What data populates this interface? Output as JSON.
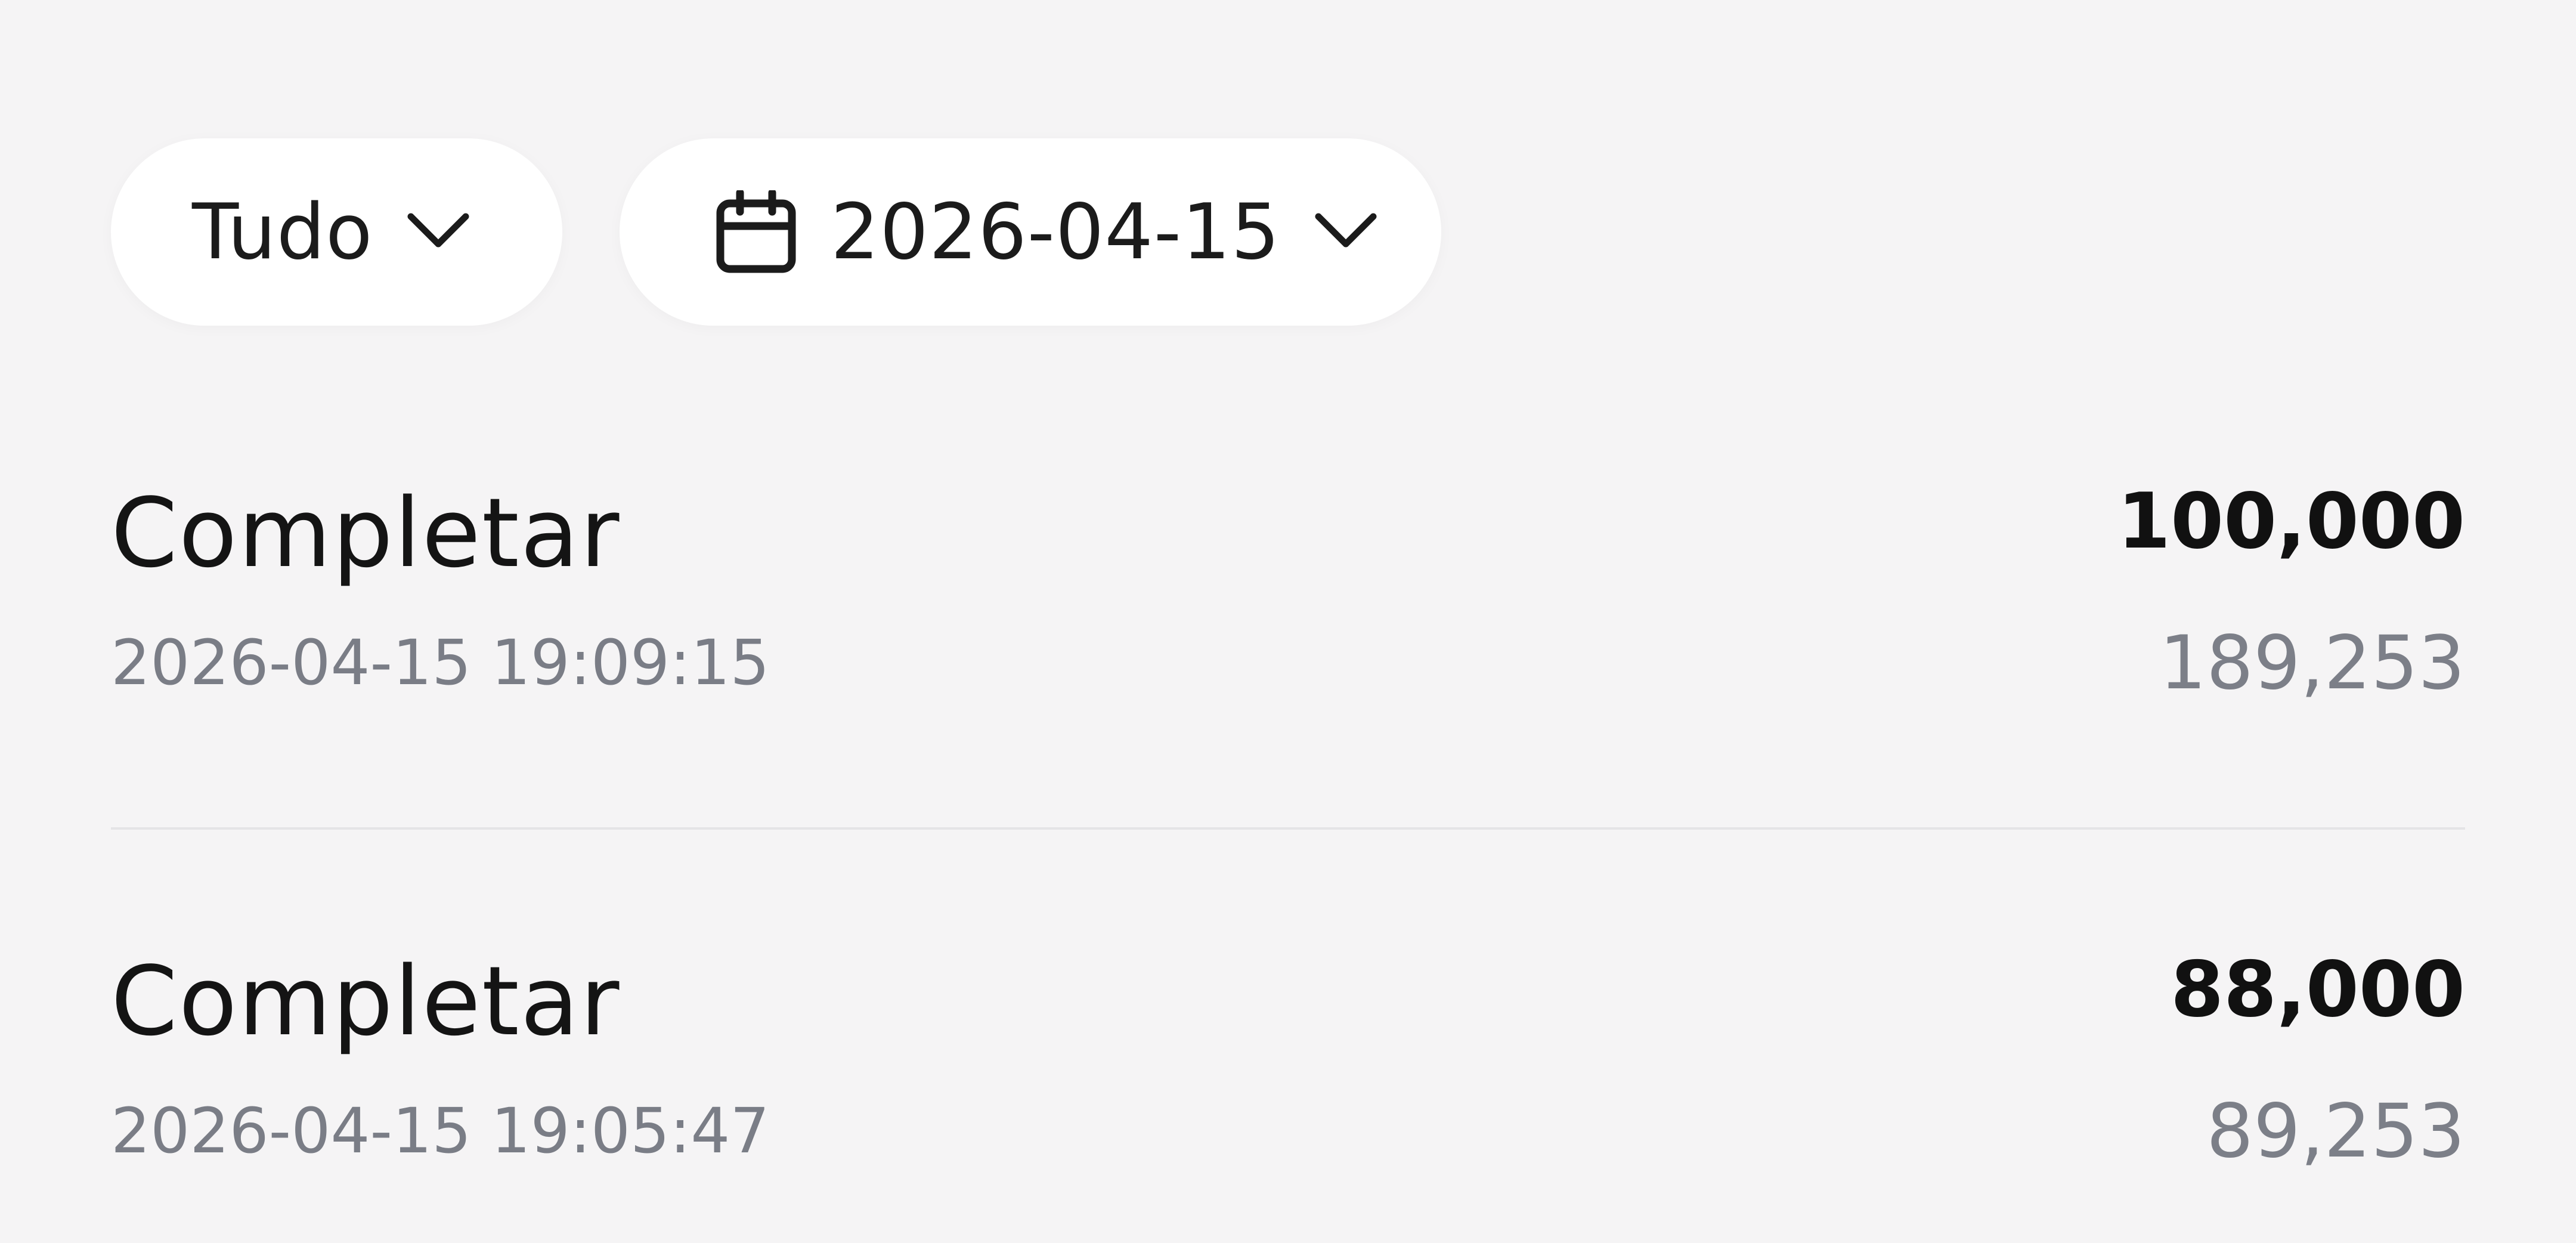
{
  "filters": {
    "type_label": "Tudo",
    "date_label": "2026-04-15"
  },
  "records": [
    {
      "status": "Completar",
      "datetime": "2026-04-15 19:09:15",
      "amount": "100,000",
      "balance": "189,253"
    },
    {
      "status": "Completar",
      "datetime": "2026-04-15 19:05:47",
      "amount": "88,000",
      "balance": "89,253"
    }
  ],
  "icons": {
    "type_dropdown": "chevron-down-icon",
    "date_picker": "calendar-icon",
    "date_dropdown": "chevron-down-icon"
  },
  "colors": {
    "background": "#f5f4f5",
    "pill": "#ffffff",
    "primary_text": "#141414",
    "secondary_text": "#7a7d86",
    "divider": "#e4e4e6"
  }
}
